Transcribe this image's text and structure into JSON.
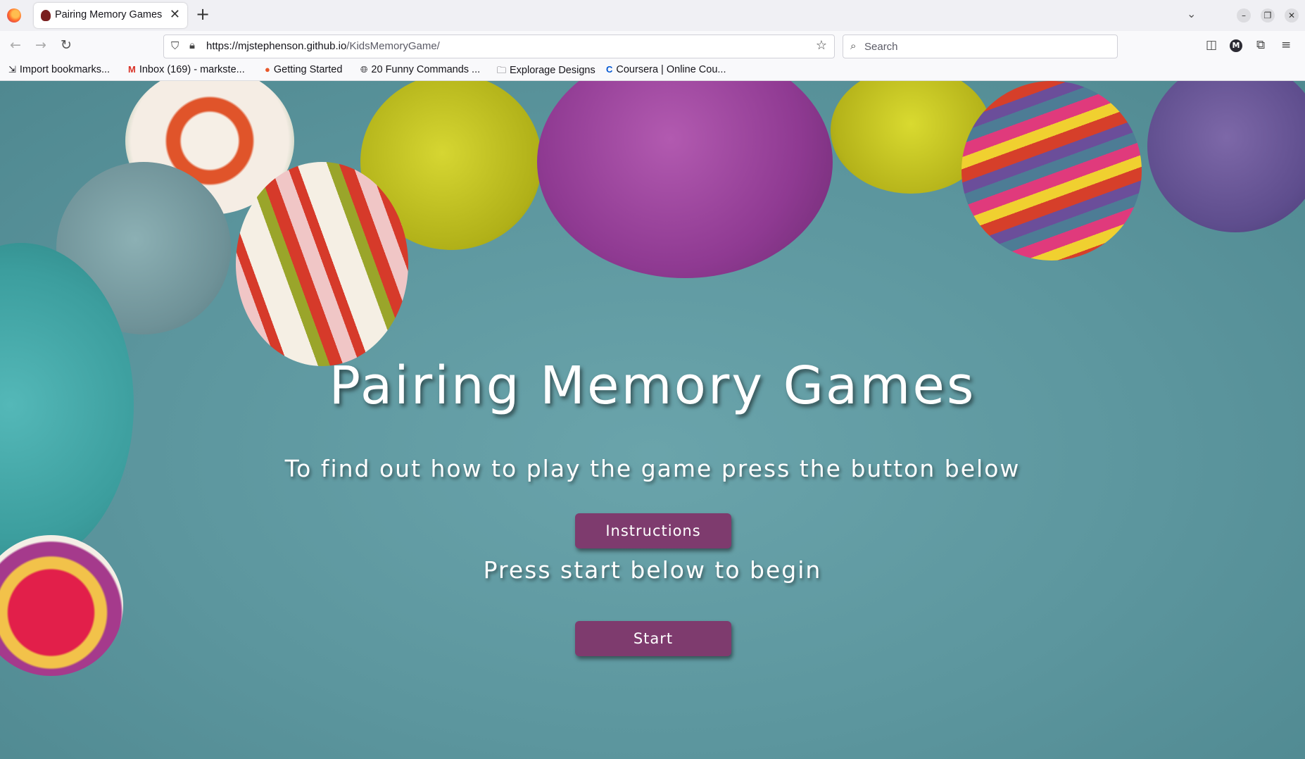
{
  "browser": {
    "tab_title": "Pairing Memory Games",
    "tab_close": "✕",
    "new_tab": "+",
    "url_host": "https://mjstephenson.github.io",
    "url_path": "/KidsMemoryGame/",
    "search_placeholder": "Search",
    "account_initial": "M"
  },
  "bookmarks": [
    {
      "label": "Import bookmarks..."
    },
    {
      "label": "Inbox (169) - markste..."
    },
    {
      "label": "Getting Started"
    },
    {
      "label": "20 Funny Commands ..."
    },
    {
      "label": "Explorage Designs"
    },
    {
      "label": "Coursera | Online Cou..."
    }
  ],
  "page": {
    "title": "Pairing Memory Games",
    "instructions_prompt": "To find out how to play the game press the button below",
    "instructions_button": "Instructions",
    "start_prompt": "Press start below to begin",
    "start_button": "Start"
  },
  "colors": {
    "background": "#5c969e",
    "button": "#7e3b6e"
  }
}
